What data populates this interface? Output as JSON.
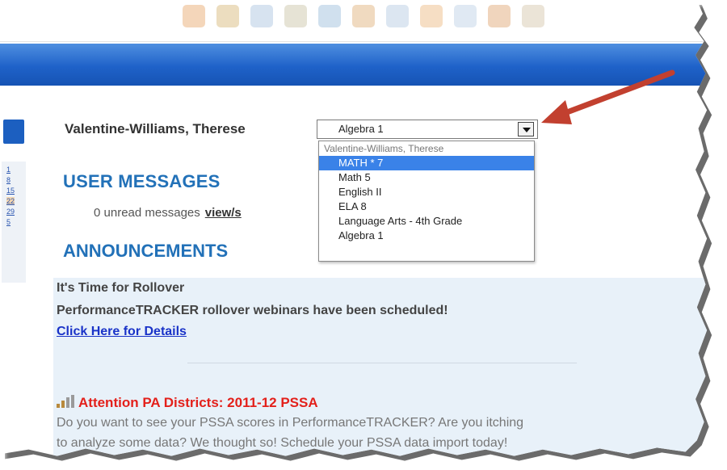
{
  "user": {
    "name": "Valentine-Williams, Therese"
  },
  "course_select": {
    "selected": "Algebra 1",
    "options": [
      "Valentine-Williams, Therese",
      "MATH * 7",
      "Math 5",
      "English II",
      "ELA 8",
      "Language Arts - 4th Grade",
      "Algebra 1"
    ],
    "highlighted_index": 1
  },
  "calendar": {
    "days": [
      "1",
      "8",
      "15",
      "22",
      "29",
      "5"
    ],
    "highlighted_day": "22"
  },
  "messages": {
    "heading": "USER MESSAGES",
    "unread_text": "0 unread messages",
    "view_link": "view/s"
  },
  "announcements": {
    "heading": "ANNOUNCEMENTS",
    "rollover_title": "It's Time for Rollover",
    "rollover_body": "PerformanceTRACKER rollover webinars have been scheduled!",
    "details_link": "Click Here for Details",
    "pssa_title": "Attention PA Districts: 2011-12 PSSA",
    "pssa_line1": "Do you want to see your PSSA scores in PerformanceTRACKER? Are you itching",
    "pssa_line2": "to analyze some data? We thought so! Schedule your PSSA data import today!"
  },
  "colors": {
    "accent_blue": "#2271b8",
    "nav_bar": "#1f62c9",
    "annotation_arrow": "#c2402f",
    "alert_red": "#e3201b"
  }
}
